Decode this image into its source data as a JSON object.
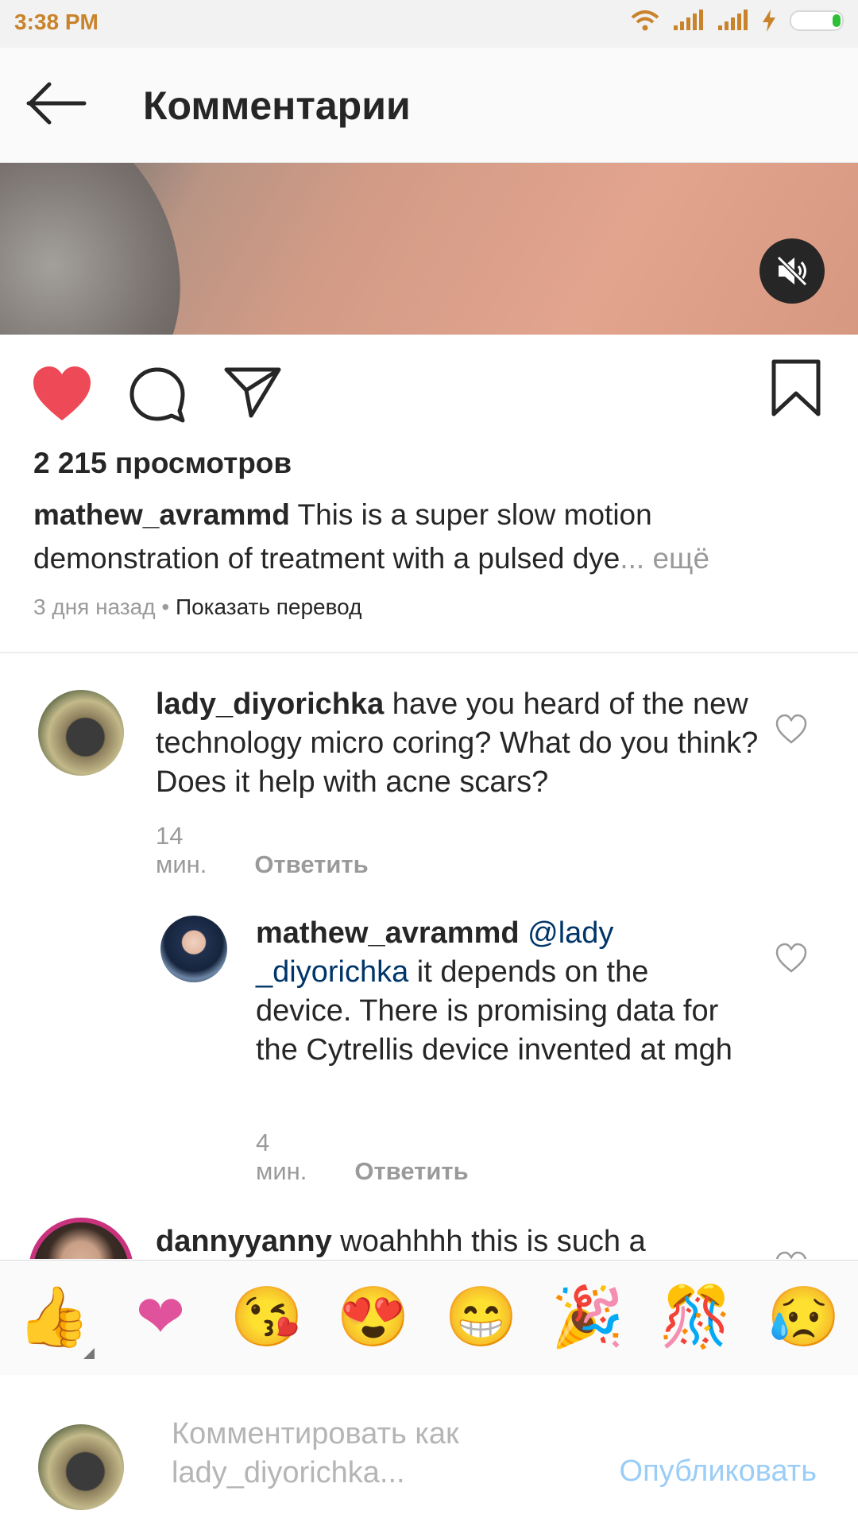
{
  "status_bar": {
    "time": "3:38 PM"
  },
  "header": {
    "title": "Комментарии"
  },
  "post": {
    "views": "2 215 просмотров",
    "caption_user": "mathew_avrammd",
    "caption_text": " This is a super slow motion demonstration of treatment with a pulsed dye",
    "caption_more": "... ещё",
    "time_ago": "3 дня назад",
    "separator": " • ",
    "translate": "Показать перевод"
  },
  "comments": [
    {
      "user": "lady_diyorichka",
      "text": " have you heard of the new technology micro coring? What do you think? Does it help with acne scars?",
      "time": "14 мин.",
      "reply": "Ответить"
    },
    {
      "user": "mathew_avrammd",
      "mention": " @lady _diyorichka",
      "text": " it depends on the device. There is promising data for the Cytrellis device invented at mgh",
      "time": "4 мин.",
      "reply": "Ответить"
    },
    {
      "user": "dannyyanny",
      "text": " woahhhh this is such a"
    }
  ],
  "emoji_bar": [
    "👍",
    "❤",
    "😘",
    "😍",
    "😁",
    "🎉",
    "🎊",
    "😥"
  ],
  "input": {
    "placeholder_line1": "Комментировать как",
    "placeholder_line2": "lady_diyorichka...",
    "publish": "Опубликовать"
  }
}
